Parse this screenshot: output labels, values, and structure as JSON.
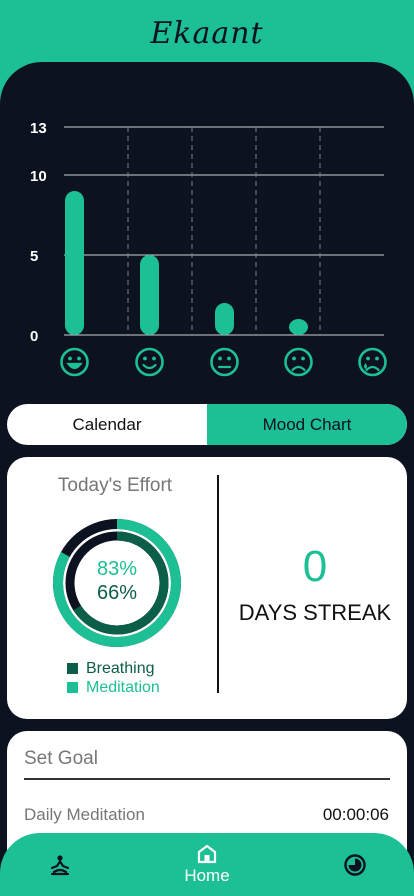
{
  "app": {
    "logo_text": "Ekaant"
  },
  "chart_data": {
    "type": "bar",
    "categories": [
      "very-happy",
      "happy",
      "neutral",
      "sad",
      "crying"
    ],
    "values": [
      9,
      5,
      2,
      1,
      0
    ],
    "yticks": [
      0,
      5,
      10,
      13
    ],
    "ylim": [
      0,
      13
    ],
    "bar_color": "#1dbf95",
    "grid": true
  },
  "toggle": {
    "calendar_label": "Calendar",
    "mood_chart_label": "Mood Chart",
    "active": "Mood Chart"
  },
  "effort": {
    "title": "Today's Effort",
    "meditation_percent_label": "83%",
    "breathing_percent_label": "66%",
    "meditation_progress": 0.83,
    "breathing_progress": 0.66,
    "legend_breathing": "Breathing",
    "legend_meditation": "Meditation",
    "color_breathing": "#0b5e48",
    "color_meditation": "#1dbf95"
  },
  "streak": {
    "count": "0",
    "label": "DAYS STREAK"
  },
  "goal": {
    "title": "Set Goal",
    "daily_meditation_label": "Daily Meditation",
    "daily_meditation_value": "00:00:06"
  },
  "nav": {
    "home_label": "Home",
    "items": [
      "meditation-icon",
      "home-icon",
      "timer-icon"
    ]
  },
  "colors": {
    "accent": "#1dbf95",
    "background": "#0d1220",
    "card": "#ffffff"
  }
}
